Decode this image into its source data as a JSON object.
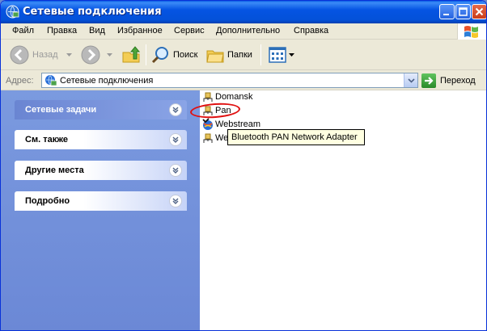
{
  "window": {
    "title": "Сетевые подключения"
  },
  "menu": [
    "Файл",
    "Правка",
    "Вид",
    "Избранное",
    "Сервис",
    "Дополнительно",
    "Справка"
  ],
  "toolbar": {
    "back_label": "Назад",
    "search_label": "Поиск",
    "folders_label": "Папки"
  },
  "address": {
    "label": "Адрес:",
    "value": "Сетевые подключения",
    "go_label": "Переход"
  },
  "taskpane": {
    "panels": [
      {
        "label": "Сетевые задачи"
      },
      {
        "label": "См. также"
      },
      {
        "label": "Другие места"
      },
      {
        "label": "Подробно"
      }
    ]
  },
  "connections": [
    {
      "label": "Domansk",
      "icon": "lan-connection-icon"
    },
    {
      "label": "Pan",
      "icon": "lan-connection-icon"
    },
    {
      "label": "Webstream",
      "icon": "internet-connection-icon"
    },
    {
      "label": "We",
      "icon": "lan-connection-icon"
    }
  ],
  "tooltip": {
    "text": "Bluetooth PAN Network Adapter"
  },
  "colors": {
    "titlebar": "#0554e3",
    "taskpane": "#7b9adf",
    "highlight": "#e01010",
    "tooltip_bg": "#ffffe1"
  }
}
